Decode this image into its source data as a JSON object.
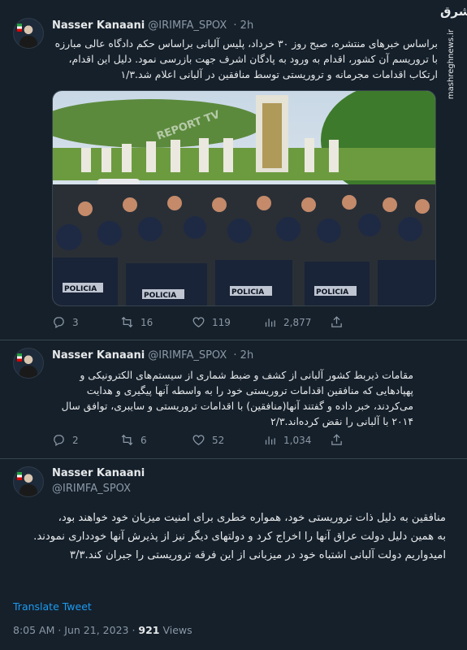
{
  "watermark": {
    "logo": "مشرق",
    "site": "mashreghnews.ir"
  },
  "tweets": [
    {
      "name": "Nasser Kanaani",
      "handle": "@IRIMFA_SPOX",
      "dot": "·",
      "time": "2h",
      "text": "براساس خبرهای منتشره، صبح روز ۳۰ خرداد، پلیس آلبانی براساس حکم دادگاه عالی مبارزه با تروریسم آن کشور، اقدام به ورود به پادگان اشرف جهت بازرسی نمود. دلیل این اقدام، ارتکاب اقدامات مجرمانه و تروریستی توسط منافقین در آلبانی اعلام شد.۱/۳",
      "photo_labels": [
        "POLICIA",
        "POLICIA",
        "POLICIA",
        "POLICIA",
        "REPORT TV"
      ],
      "replies": "3",
      "retweets": "16",
      "likes": "119",
      "views": "2,877"
    },
    {
      "name": "Nasser Kanaani",
      "handle": "@IRIMFA_SPOX",
      "dot": "·",
      "time": "2h",
      "text": "مقامات ذیربط کشور آلبانی از کشف و ضبط شماری از سیستم‌های الکترونیکی و پهپادهایی که منافقین اقدامات تروریستی خود را به واسطه آنها پیگیری و هدایت می‌کردند، خبر داده و گفتند آنها(منافقین) با اقدامات تروریستی و سایبری، توافق سال ۲۰۱۴ با آلبانی را نقض کرده‌اند.۲/۳",
      "replies": "2",
      "retweets": "6",
      "likes": "52",
      "views": "1,034"
    },
    {
      "name": "Nasser Kanaani",
      "handle": "@IRIMFA_SPOX",
      "text": "منافقین به دلیل ذات تروریستی خود، همواره خطری برای امنیت میزبان خود خواهند بود،\nبه همین دلیل دولت عراق آنها را اخراج کرد و دولتهای دیگر نیز از پذیرش آنها خودداری نمودند. امیدواریم دولت آلبانی اشتباه خود در میزبانی از این فرقه تروریستی را جبران کند.۳/۳",
      "translate": "Translate Tweet",
      "time_full": "8:05 AM · Jun 21, 2023 · ",
      "views_count": "921",
      "views_label": " Views"
    }
  ]
}
